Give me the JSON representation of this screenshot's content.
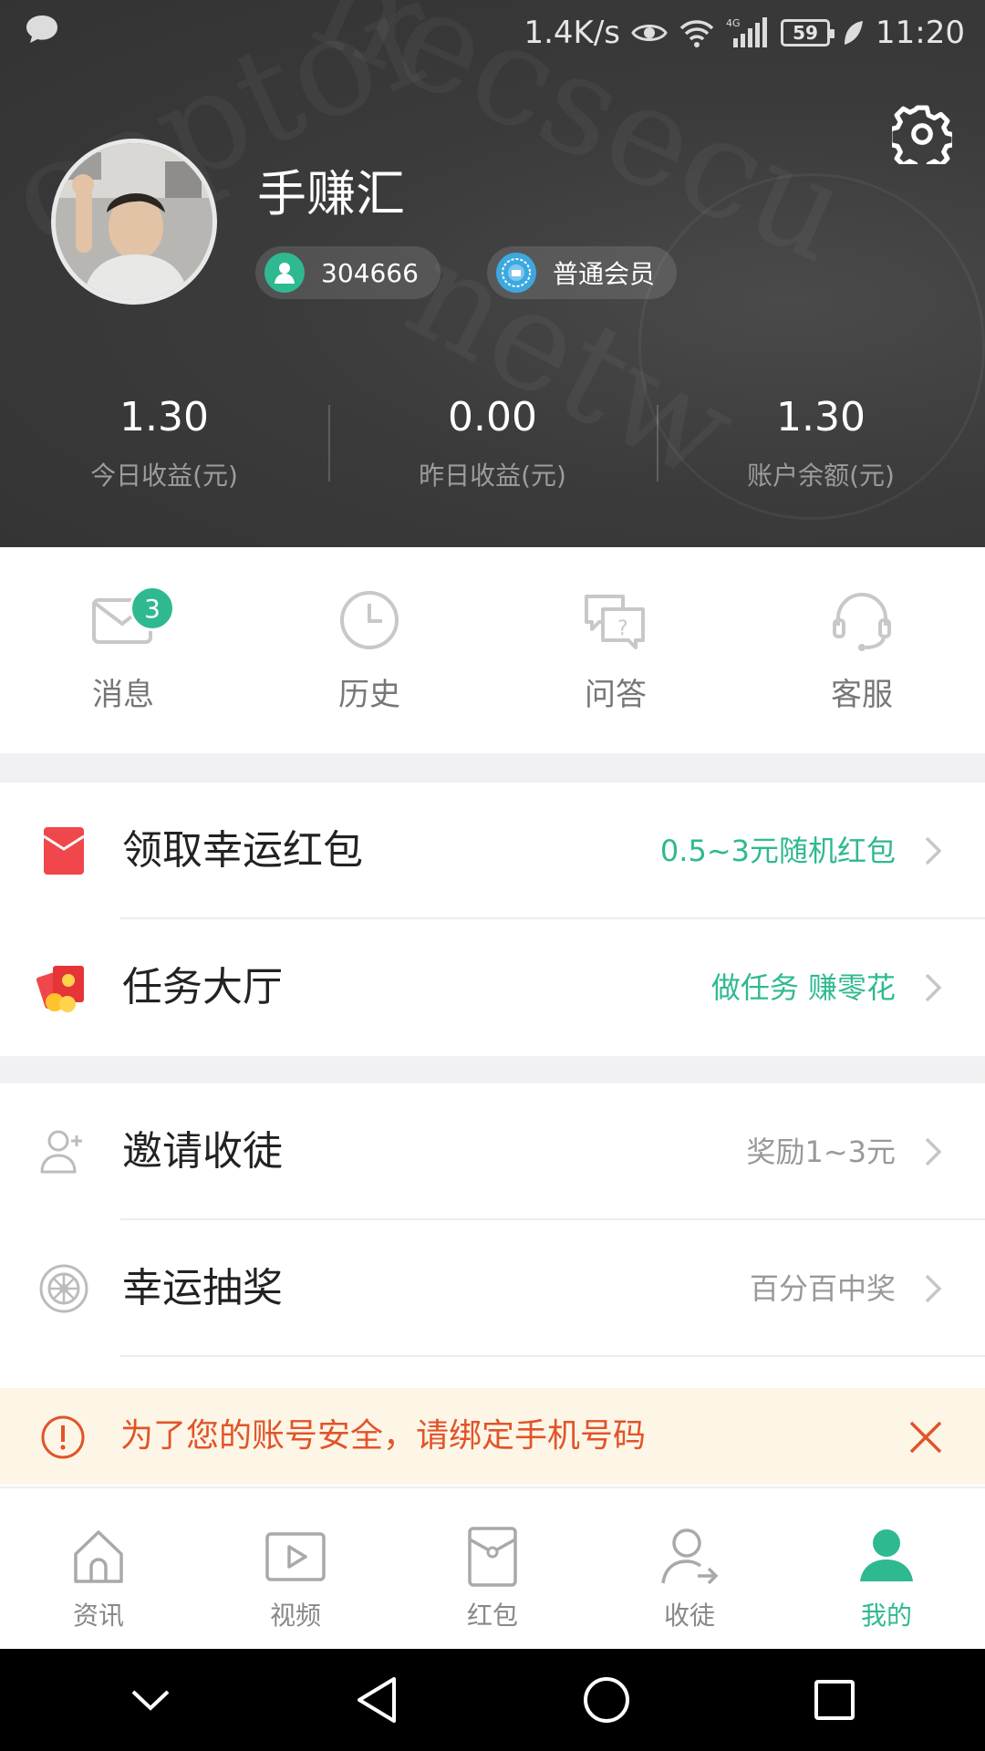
{
  "status_bar": {
    "speed": "1.4K/s",
    "network": "4G",
    "battery": "59",
    "time": "11:20"
  },
  "profile": {
    "name": "手赚汇",
    "user_id": "304666",
    "membership": "普通会员"
  },
  "stats": [
    {
      "value": "1.30",
      "label": "今日收益(元)"
    },
    {
      "value": "0.00",
      "label": "昨日收益(元)"
    },
    {
      "value": "1.30",
      "label": "账户余额(元)"
    }
  ],
  "quick_actions": [
    {
      "label": "消息",
      "icon": "mail-icon",
      "badge": "3"
    },
    {
      "label": "历史",
      "icon": "clock-icon"
    },
    {
      "label": "问答",
      "icon": "qa-icon"
    },
    {
      "label": "客服",
      "icon": "headset-icon"
    }
  ],
  "menu": [
    {
      "title": "领取幸运红包",
      "hint": "0.5~3元随机红包",
      "icon": "red-envelope-icon"
    },
    {
      "title": "任务大厅",
      "hint": "做任务 赚零花",
      "icon": "task-gift-icon"
    },
    {
      "title": "邀请收徒",
      "hint": "奖励1~3元",
      "icon": "invite-user-icon"
    },
    {
      "title": "幸运抽奖",
      "hint": "百分百中奖",
      "icon": "wheel-icon"
    }
  ],
  "notice": {
    "text": "为了您的账号安全，请绑定手机号码"
  },
  "tabs": [
    {
      "label": "资讯",
      "icon": "home-icon"
    },
    {
      "label": "视频",
      "icon": "video-icon"
    },
    {
      "label": "红包",
      "icon": "red-packet-icon"
    },
    {
      "label": "收徒",
      "icon": "disciple-icon"
    },
    {
      "label": "我的",
      "icon": "profile-icon",
      "active": true
    }
  ],
  "colors": {
    "accent": "#2fb991",
    "notice_text": "#e1542a",
    "notice_bg": "#fdf6e6",
    "header_bg": "#3b3b3b"
  }
}
